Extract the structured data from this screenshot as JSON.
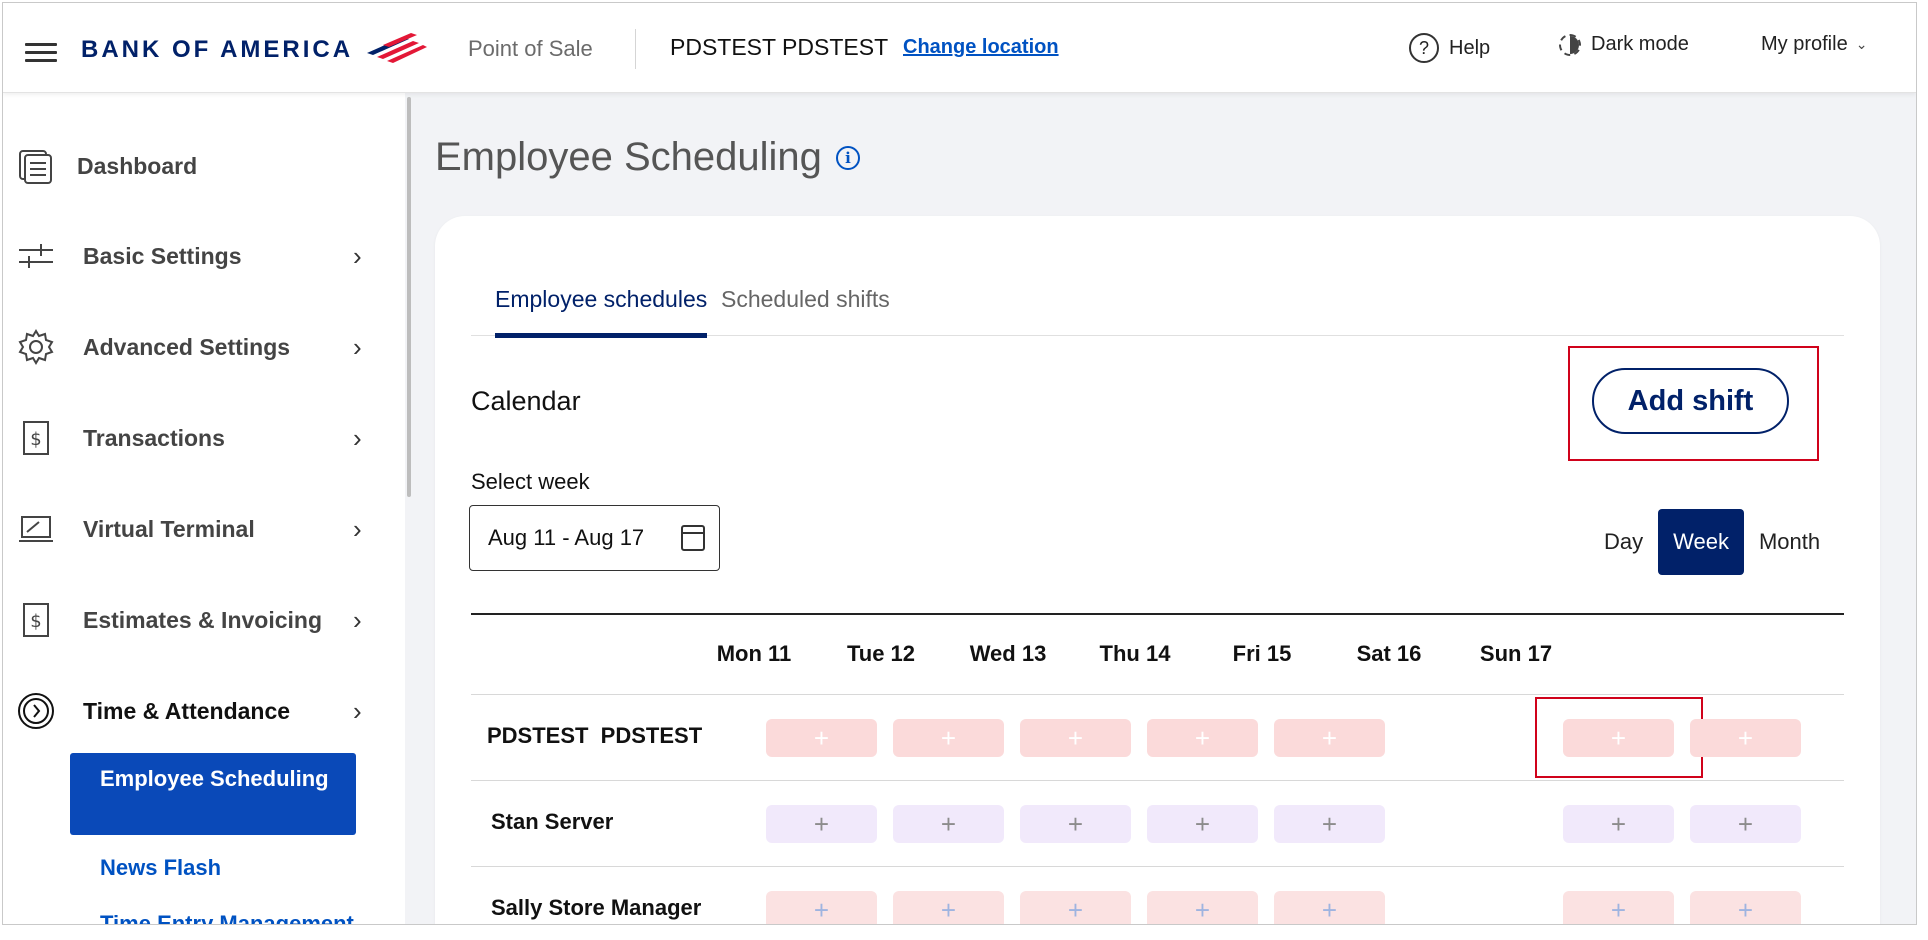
{
  "header": {
    "brand": "BANK OF AMERICA",
    "product": "Point of Sale",
    "merchant": "PDSTEST PDSTEST",
    "change_location": "Change location",
    "help": "Help",
    "dark_mode": "Dark mode",
    "my_profile": "My profile"
  },
  "sidebar": {
    "items": [
      {
        "label": "Dashboard",
        "icon": "dashboard-icon"
      },
      {
        "label": "Basic Settings",
        "icon": "sliders-icon"
      },
      {
        "label": "Advanced Settings",
        "icon": "gear-icon"
      },
      {
        "label": "Transactions",
        "icon": "receipt-dollar-icon"
      },
      {
        "label": "Virtual Terminal",
        "icon": "laptop-icon"
      },
      {
        "label": "Estimates & Invoicing",
        "icon": "invoice-dollar-icon"
      },
      {
        "label": "Time & Attendance",
        "icon": "clock-icon"
      }
    ],
    "sub_items": [
      "Employee Scheduling",
      "News Flash",
      "Time Entry Management"
    ],
    "active_sub": "Employee Scheduling"
  },
  "page": {
    "title": "Employee Scheduling"
  },
  "tabs": {
    "active": "Employee schedules",
    "inactive": "Scheduled shifts"
  },
  "calendar": {
    "title": "Calendar",
    "add_shift": "Add shift",
    "select_week_label": "Select week",
    "week_value": "Aug 11 - Aug 17",
    "views": [
      "Day",
      "Week",
      "Month"
    ],
    "selected_view": "Week",
    "days": [
      "Mon 11",
      "Tue 12",
      "Wed 13",
      "Thu 14",
      "Fri 15",
      "Sat 16",
      "Sun 17"
    ],
    "employees": [
      "PDSTEST  PDSTEST",
      "Stan Server",
      "Sally Store Manager"
    ],
    "cell_symbol": "+"
  },
  "colors": {
    "brand_navy": "#012169",
    "link_blue": "#0052c2",
    "active_nav": "#0a49b8",
    "highlight_red": "#d0021b"
  }
}
